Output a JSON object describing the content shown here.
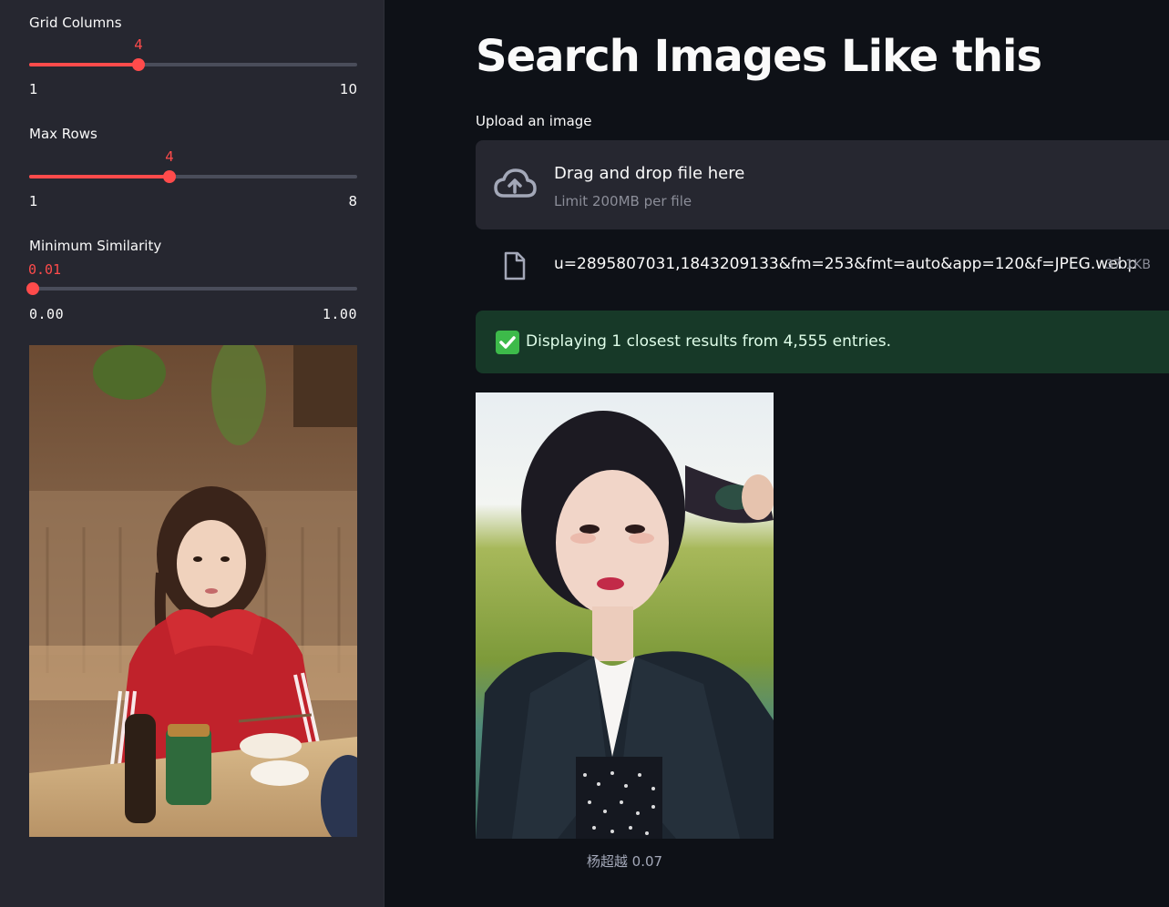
{
  "sidebar": {
    "sliders": [
      {
        "label": "Grid Columns",
        "value": "4",
        "min": "1",
        "max": "10",
        "fraction": 0.3333
      },
      {
        "label": "Max Rows",
        "value": "4",
        "min": "1",
        "max": "8",
        "fraction": 0.4286
      },
      {
        "label": "Minimum Similarity",
        "value": "0.01",
        "min": "0.00",
        "max": "1.00",
        "fraction": 0.01
      }
    ],
    "query_image": {
      "icon": "query-photo"
    }
  },
  "main": {
    "title": "Search Images Like this",
    "uploader": {
      "label": "Upload an image",
      "drop_title": "Drag and drop file here",
      "drop_limit": "Limit 200MB per file",
      "file_name": "u=2895807031,1843209133&fm=253&fmt=auto&app=120&f=JPEG.webp",
      "file_size": "37.1KB"
    },
    "status": {
      "icon": "✅",
      "text": "Displaying 1 closest results from 4,555 entries."
    },
    "results": [
      {
        "caption": "杨超越 0.07"
      }
    ]
  },
  "colors": {
    "accent": "#ff4b4b",
    "background": "#0e1117",
    "sidebar": "#262730",
    "success_bg": "#173928"
  }
}
